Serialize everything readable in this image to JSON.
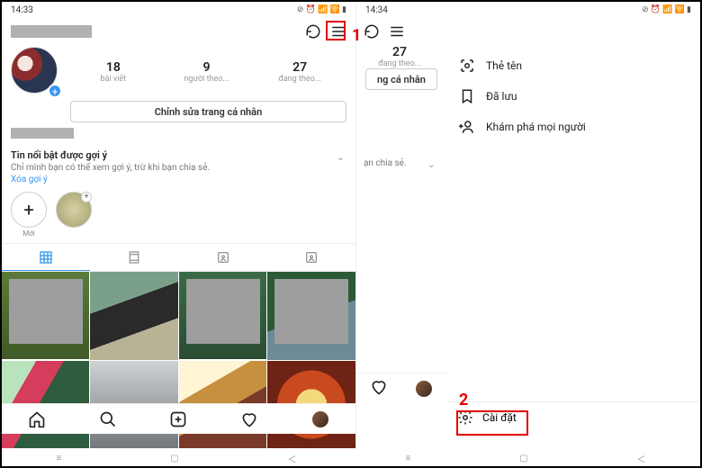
{
  "left": {
    "time": "14:33",
    "stats": {
      "posts": {
        "num": "18",
        "label": "bài viết"
      },
      "followers": {
        "num": "9",
        "label": "người theo..."
      },
      "following": {
        "num": "27",
        "label": "đang theo..."
      }
    },
    "edit_label": "Chỉnh sửa trang cá nhân",
    "suggest": {
      "title": "Tin nổi bật được gợi ý",
      "sub": "Chỉ mình bạn có thể xem gợi ý, trừ khi bạn chia sẻ.",
      "clear": "Xóa gợi ý"
    },
    "highlights": {
      "new": "Mới",
      "h1": ""
    }
  },
  "right": {
    "time": "14:34",
    "stat": {
      "num": "27",
      "label": "đang theo..."
    },
    "edit_label": "ng cá nhân",
    "suggest_frag": "ạn chia sẻ.",
    "menu": {
      "nametag": "Thẻ tên",
      "saved": "Đã lưu",
      "discover": "Khám phá mọi người"
    },
    "settings": "Cài đặt"
  },
  "annotations": {
    "one": "1",
    "two": "2"
  },
  "status_icons": "⊘ ⏰ 📶 🛜 ▮"
}
